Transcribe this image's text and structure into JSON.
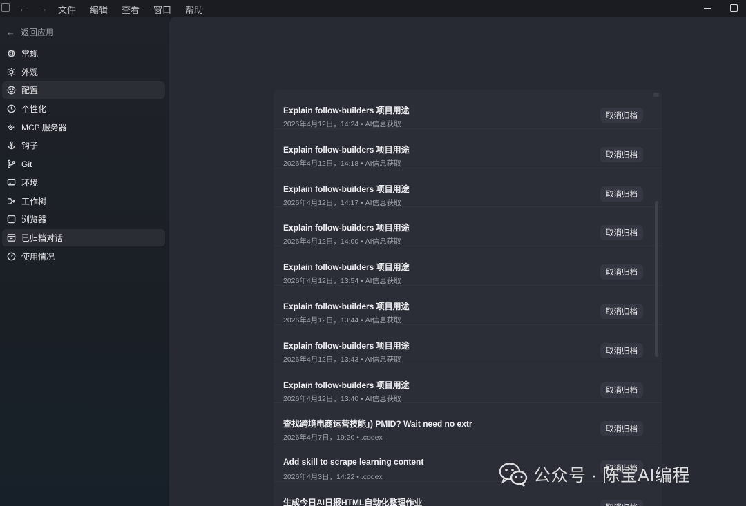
{
  "menu": [
    "文件",
    "编辑",
    "查看",
    "窗口",
    "帮助"
  ],
  "sidebar": {
    "back_label": "返回应用",
    "items": [
      {
        "label": "常规",
        "icon": "gear-icon"
      },
      {
        "label": "外观",
        "icon": "sun-icon"
      },
      {
        "label": "配置",
        "icon": "config-icon",
        "active": true
      },
      {
        "label": "个性化",
        "icon": "smile-icon"
      },
      {
        "label": "MCP 服务器",
        "icon": "mcp-icon"
      },
      {
        "label": "钩子",
        "icon": "anchor-icon"
      },
      {
        "label": "Git",
        "icon": "git-branch-icon"
      },
      {
        "label": "环境",
        "icon": "monitor-icon"
      },
      {
        "label": "工作树",
        "icon": "worktree-icon"
      },
      {
        "label": "浏览器",
        "icon": "browser-icon"
      },
      {
        "label": "已归档对话",
        "icon": "archive-icon",
        "active": true
      },
      {
        "label": "使用情况",
        "icon": "gauge-icon"
      }
    ]
  },
  "archived": {
    "button_label": "取消归档",
    "items": [
      {
        "title": "Explain follow-builders 项目用途",
        "meta": "2026年4月12日，14:24 • AI信息获取"
      },
      {
        "title": "Explain follow-builders 项目用途",
        "meta": "2026年4月12日，14:18 • AI信息获取"
      },
      {
        "title": "Explain follow-builders 项目用途",
        "meta": "2026年4月12日，14:17 • AI信息获取"
      },
      {
        "title": "Explain follow-builders 项目用途",
        "meta": "2026年4月12日，14:00 • AI信息获取"
      },
      {
        "title": "Explain follow-builders 项目用途",
        "meta": "2026年4月12日，13:54 • AI信息获取"
      },
      {
        "title": "Explain follow-builders 项目用途",
        "meta": "2026年4月12日，13:44 • AI信息获取"
      },
      {
        "title": "Explain follow-builders 项目用途",
        "meta": "2026年4月12日，13:43 • AI信息获取"
      },
      {
        "title": "Explain follow-builders 项目用途",
        "meta": "2026年4月12日，13:40 • AI信息获取"
      },
      {
        "title": "查找跨境电商运营技能」) PMID? Wait need no extr",
        "meta": "2026年4月7日，19:20 • .codex"
      },
      {
        "title": "Add skill to scrape learning content",
        "meta": "2026年4月3日，14:22 • .codex"
      },
      {
        "title": "生成今日AI日报HTML自动化整理作业",
        "meta": ""
      }
    ]
  },
  "watermark": {
    "text": "公众号 · 陈宝AI编程"
  }
}
